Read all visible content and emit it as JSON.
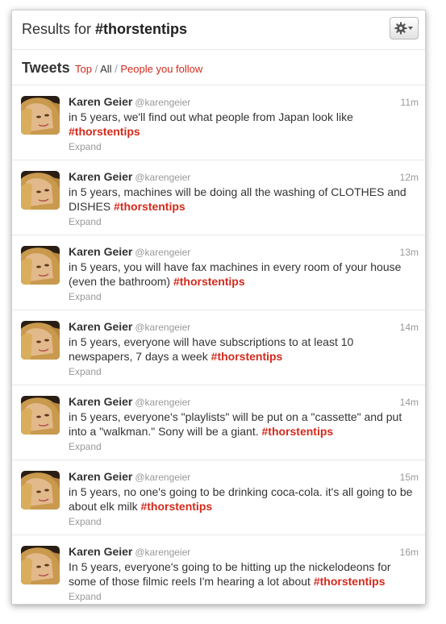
{
  "header": {
    "results_prefix": "Results for ",
    "query": "#thorstentips"
  },
  "tweets_section": {
    "title": "Tweets",
    "filter_top": "Top",
    "separator": " / ",
    "filter_all": "All",
    "filter_people": "People you follow"
  },
  "colors": {
    "accent": "#d32a1c",
    "muted": "#999999",
    "text": "#333333"
  },
  "icons": {
    "settings": "gear-icon",
    "dropdown": "caret-down-icon"
  },
  "tweets": [
    {
      "name": "Karen Geier",
      "handle": "@karengeier",
      "time": "11m",
      "text": "in 5 years, we'll find out what people from Japan look like ",
      "hashtag": "#thorstentips",
      "expand": "Expand"
    },
    {
      "name": "Karen Geier",
      "handle": "@karengeier",
      "time": "12m",
      "text": "in 5 years, machines will be doing all the washing of CLOTHES and DISHES ",
      "hashtag": "#thorstentips",
      "expand": "Expand"
    },
    {
      "name": "Karen Geier",
      "handle": "@karengeier",
      "time": "13m",
      "text": "in 5 years, you will have fax machines in every room of your house (even the bathroom) ",
      "hashtag": "#thorstentips",
      "expand": "Expand"
    },
    {
      "name": "Karen Geier",
      "handle": "@karengeier",
      "time": "14m",
      "text": "in 5 years, everyone will have subscriptions to at least 10 newspapers, 7 days a week ",
      "hashtag": "#thorstentips",
      "expand": "Expand"
    },
    {
      "name": "Karen Geier",
      "handle": "@karengeier",
      "time": "14m",
      "text": "in 5 years, everyone's \"playlists\" will be put on a \"cassette\" and put into a \"walkman.\" Sony will be a giant. ",
      "hashtag": "#thorstentips",
      "expand": "Expand"
    },
    {
      "name": "Karen Geier",
      "handle": "@karengeier",
      "time": "15m",
      "text": "in 5 years, no one's going to be drinking coca-cola. it's all going to be about elk milk ",
      "hashtag": "#thorstentips",
      "expand": "Expand"
    },
    {
      "name": "Karen Geier",
      "handle": "@karengeier",
      "time": "16m",
      "text": "In 5 years, everyone's going to be hitting up the nickelodeons for some of those filmic reels I'm hearing a lot about ",
      "hashtag": "#thorstentips",
      "expand": "Expand"
    }
  ]
}
